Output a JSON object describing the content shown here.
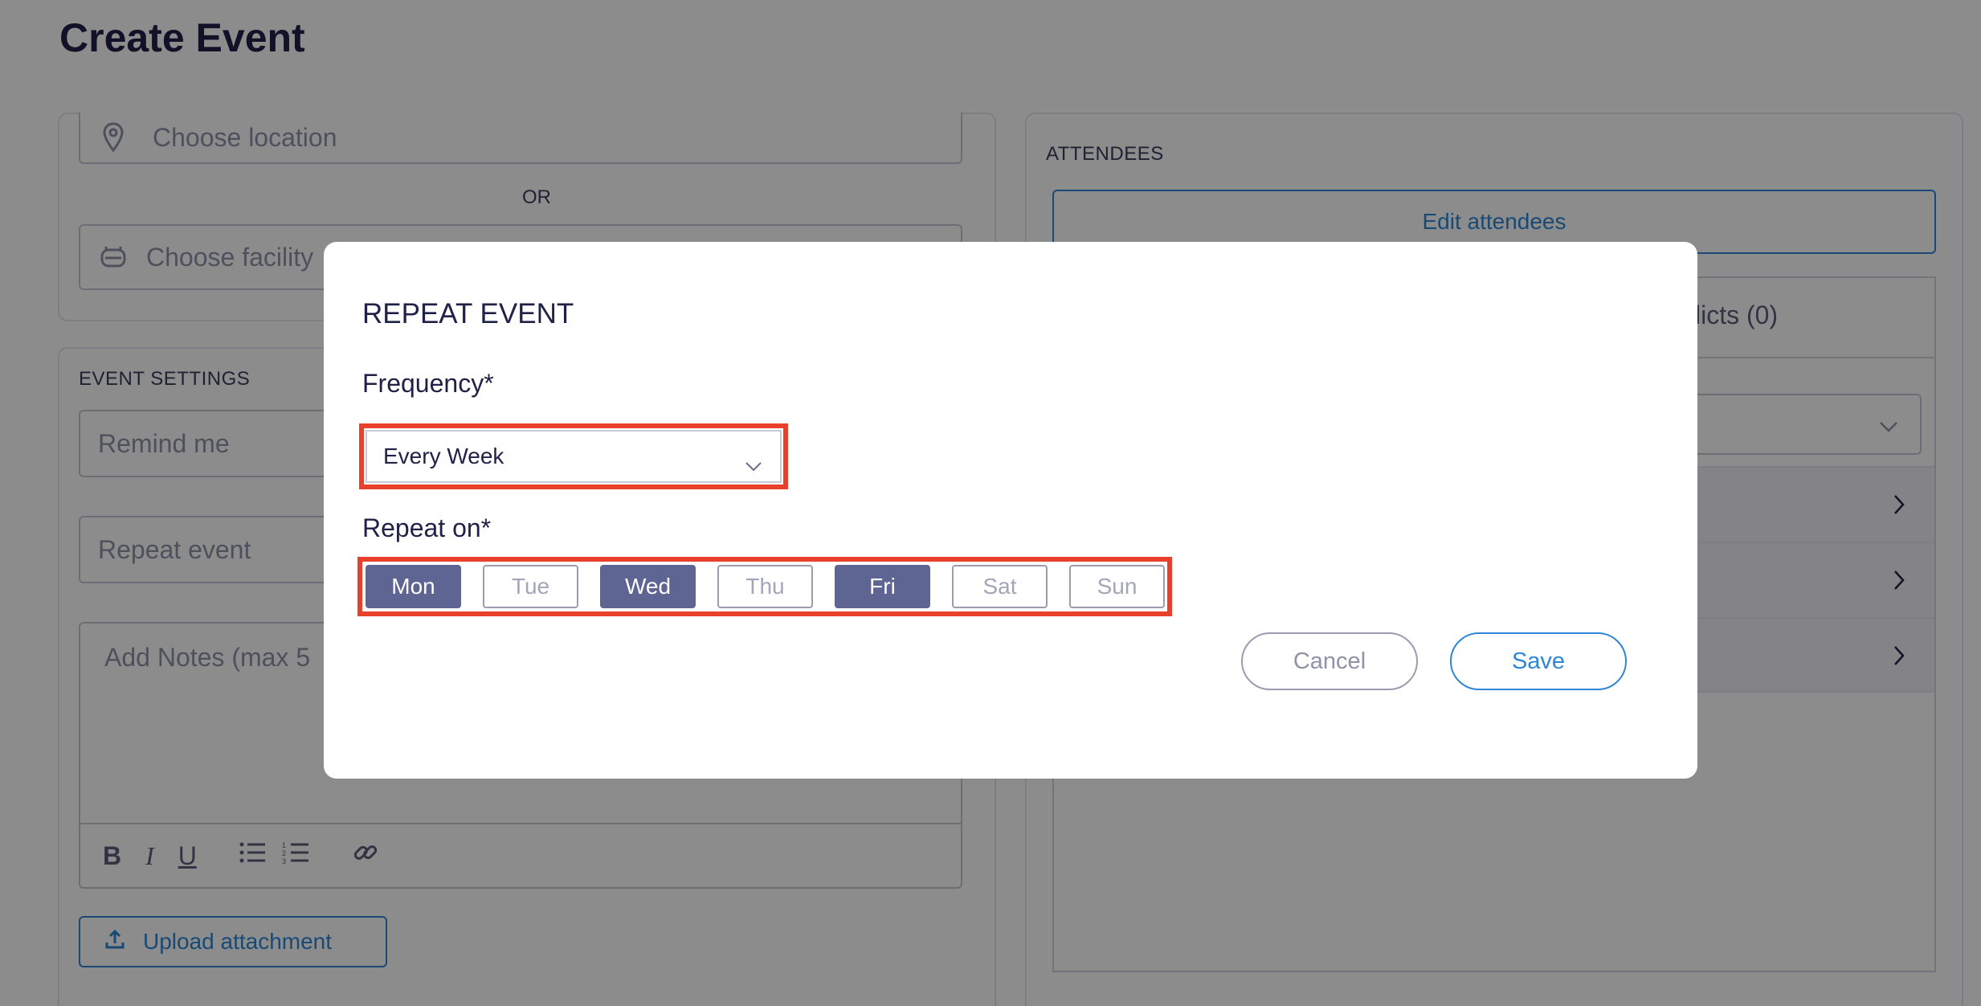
{
  "page": {
    "title": "Create Event"
  },
  "location": {
    "location_placeholder": "Choose location",
    "or_label": "OR",
    "facility_placeholder": "Choose facility"
  },
  "event_settings": {
    "heading": "EVENT SETTINGS",
    "remind_placeholder": "Remind me",
    "repeat_placeholder": "Repeat event",
    "notes_placeholder": "Add Notes (max 5",
    "upload_label": "Upload attachment"
  },
  "attendees": {
    "heading": "ATTENDEES",
    "edit_label": "Edit attendees",
    "conflicts_tab_label": "licts (0)"
  },
  "modal": {
    "title": "REPEAT EVENT",
    "frequency_label": "Frequency*",
    "frequency_value": "Every Week",
    "repeat_on_label": "Repeat on*",
    "days": [
      {
        "label": "Mon",
        "selected": true
      },
      {
        "label": "Tue",
        "selected": false
      },
      {
        "label": "Wed",
        "selected": true
      },
      {
        "label": "Thu",
        "selected": false
      },
      {
        "label": "Fri",
        "selected": true
      },
      {
        "label": "Sat",
        "selected": false
      },
      {
        "label": "Sun",
        "selected": false
      }
    ],
    "cancel_label": "Cancel",
    "save_label": "Save"
  },
  "icons": {
    "location": "location-pin-icon",
    "facility": "facility-icon",
    "bold": "bold-icon",
    "italic": "italic-icon",
    "underline": "underline-icon",
    "bullet_list": "bullet-list-icon",
    "numbered_list": "numbered-list-icon",
    "link": "link-icon",
    "upload": "upload-icon",
    "chevron_down": "chevron-down-icon",
    "chevron_right": "chevron-right-icon"
  },
  "colors": {
    "accent_blue": "#2f86d6",
    "highlight_red": "#e8402a",
    "selected_day": "#5e6592",
    "title_navy": "#1f2147"
  }
}
